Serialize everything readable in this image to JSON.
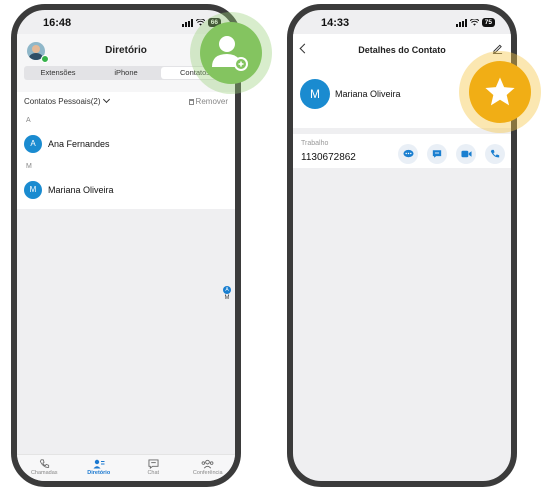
{
  "left": {
    "status_time": "16:48",
    "battery": "66",
    "title": "Diretório",
    "segments": [
      "Extensões",
      "iPhone",
      "Contatos"
    ],
    "group_label": "Contatos Pessoais(2)",
    "remove_label": "Remover",
    "letters": [
      "A",
      "M"
    ],
    "contacts": [
      {
        "initial": "A",
        "name": "Ana Fernandes"
      },
      {
        "initial": "M",
        "name": "Mariana Oliveira"
      }
    ],
    "index": [
      "A",
      "M"
    ],
    "tabs": [
      "Chamadas",
      "Diretório",
      "Chat",
      "Conferência"
    ]
  },
  "right": {
    "status_time": "14:33",
    "battery": "75",
    "title": "Detalhes do Contato",
    "avatar_initial": "M",
    "name": "Mariana Oliveira",
    "phone_label": "Trabalho",
    "phone_number": "1130672862"
  },
  "colors": {
    "accent": "#1a8bd0",
    "add_badge": "#84c460",
    "fav_badge": "#f1ae15"
  },
  "icons": {
    "add_badge": "add-person-icon",
    "fav_badge": "star-icon"
  }
}
